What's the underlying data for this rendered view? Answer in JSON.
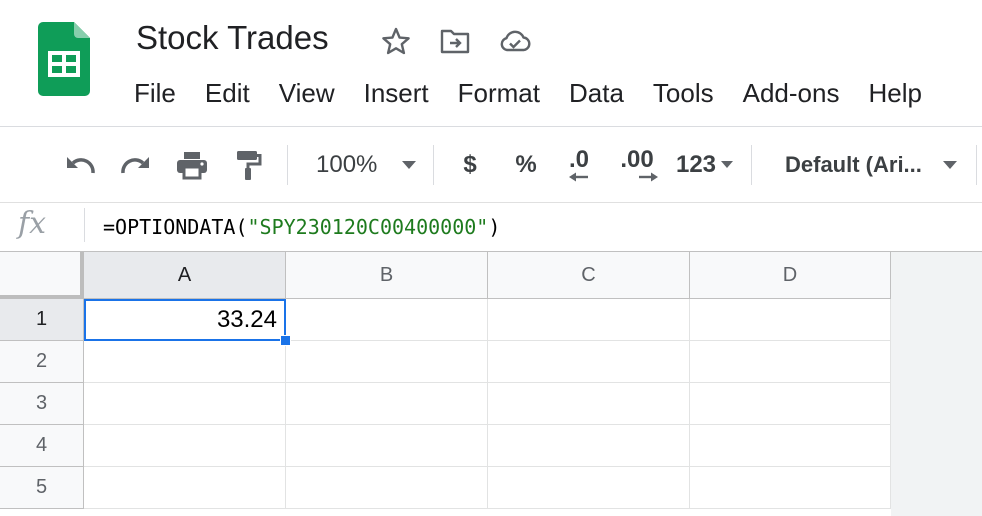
{
  "app": {
    "title": "Stock Trades",
    "menu": [
      "File",
      "Edit",
      "View",
      "Insert",
      "Format",
      "Data",
      "Tools",
      "Add-ons",
      "Help"
    ],
    "brand_color": "#0f9d58",
    "header_icons": [
      "star-icon",
      "move-to-folder-icon",
      "cloud-saved-icon"
    ]
  },
  "toolbar": {
    "zoom": "100%",
    "currency": "$",
    "percent": "%",
    "decrease_decimal": ".0",
    "increase_decimal": ".00",
    "more_formats": "123",
    "font": "Default (Ari...",
    "icons": [
      "undo-icon",
      "redo-icon",
      "print-icon",
      "paint-format-icon"
    ]
  },
  "formula_bar": {
    "fx_label": "fx",
    "formula_prefix": "=OPTIONDATA(",
    "formula_string": "\"SPY230120C00400000\"",
    "formula_suffix": ")"
  },
  "grid": {
    "columns": [
      "A",
      "B",
      "C",
      "D"
    ],
    "rows": [
      "1",
      "2",
      "3",
      "4",
      "5"
    ],
    "cells": {
      "A1": "33.24"
    },
    "selected": "A1",
    "selection_color": "#1a73e8"
  }
}
